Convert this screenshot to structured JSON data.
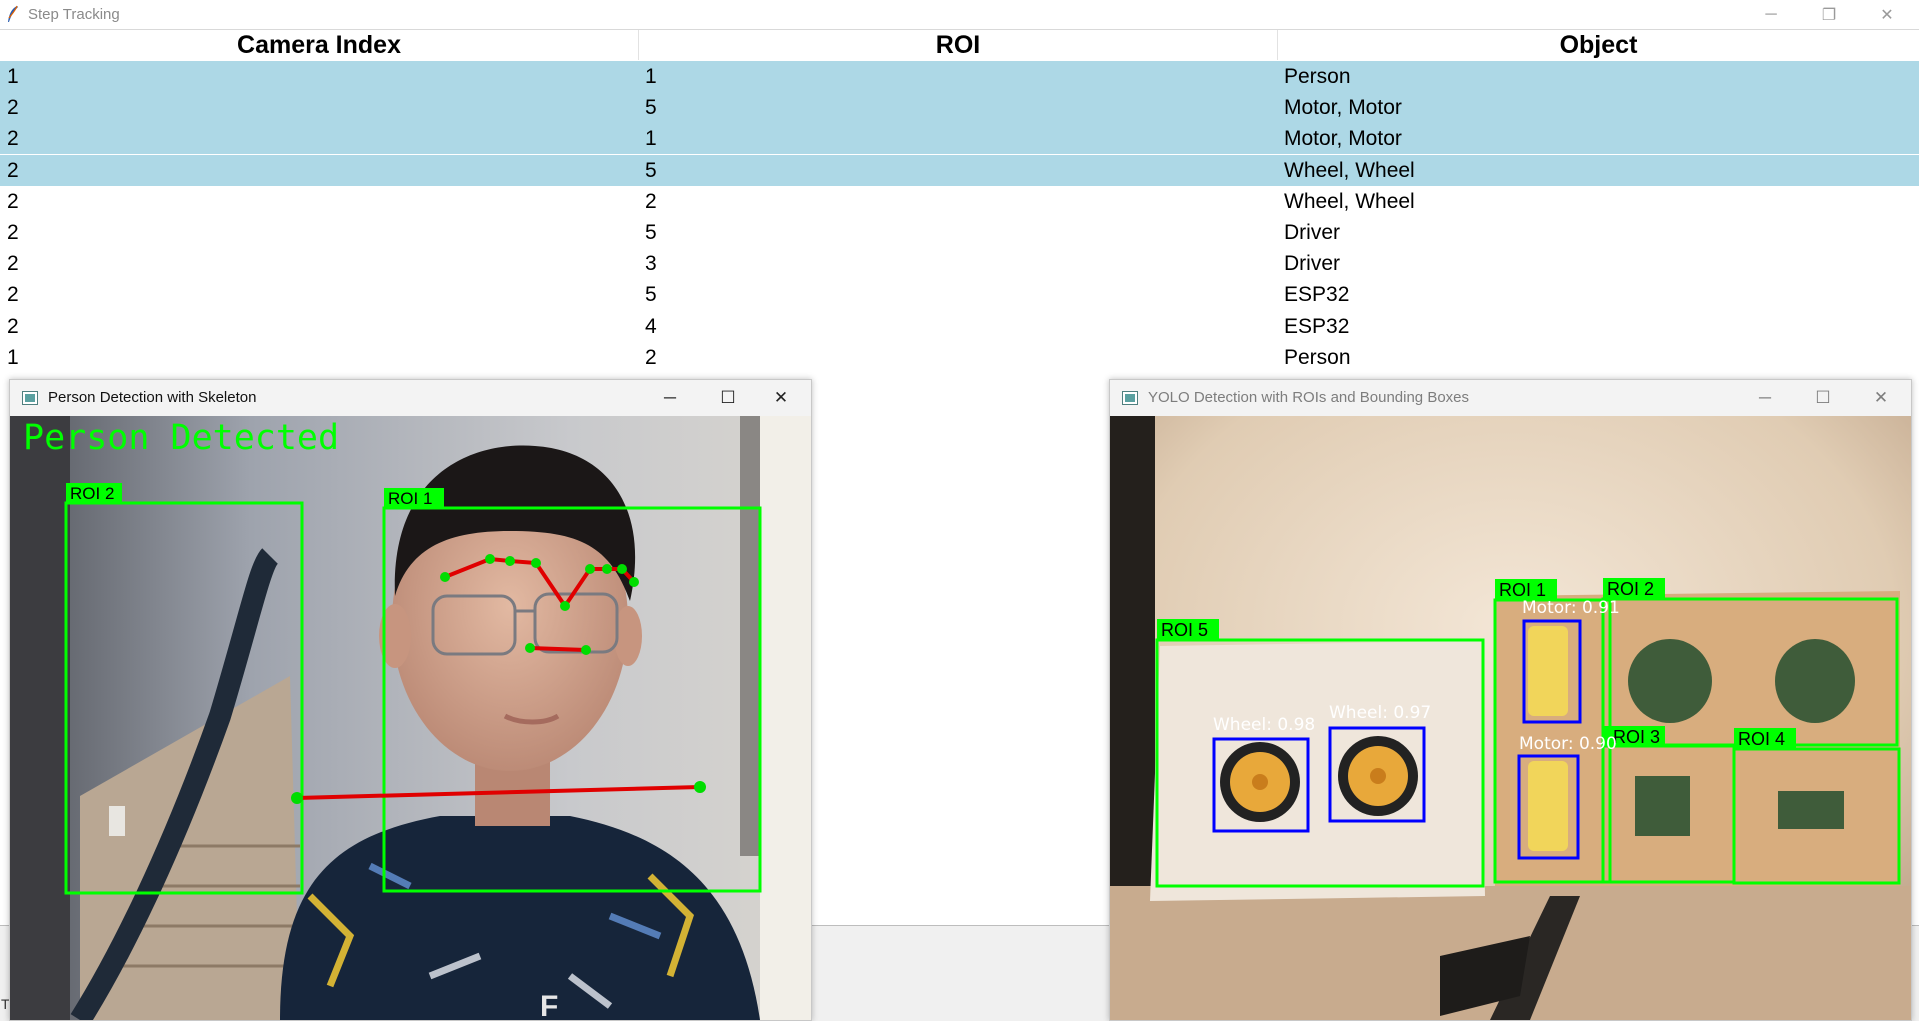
{
  "main_window": {
    "title": "Step Tracking",
    "bottom_text": "T"
  },
  "table": {
    "columns": [
      "Camera Index",
      "ROI",
      "Object"
    ],
    "rows": [
      {
        "camera": "1",
        "roi": "1",
        "object": "Person",
        "selected": true
      },
      {
        "camera": "2",
        "roi": "5",
        "object": "Motor, Motor",
        "selected": true
      },
      {
        "camera": "2",
        "roi": "1",
        "object": "Motor, Motor",
        "selected": true
      },
      {
        "camera": "2",
        "roi": "5",
        "object": "Wheel, Wheel",
        "selected": true
      },
      {
        "camera": "2",
        "roi": "2",
        "object": "Wheel, Wheel",
        "selected": false
      },
      {
        "camera": "2",
        "roi": "5",
        "object": "Driver",
        "selected": false
      },
      {
        "camera": "2",
        "roi": "3",
        "object": "Driver",
        "selected": false
      },
      {
        "camera": "2",
        "roi": "5",
        "object": "ESP32",
        "selected": false
      },
      {
        "camera": "2",
        "roi": "4",
        "object": "ESP32",
        "selected": false
      },
      {
        "camera": "1",
        "roi": "2",
        "object": "Person",
        "selected": false
      }
    ]
  },
  "person_window": {
    "title": "Person Detection with Skeleton",
    "status": "Person Detected",
    "roi_labels": [
      "ROI 2",
      "ROI 1"
    ]
  },
  "yolo_window": {
    "title": "YOLO Detection with ROIs and Bounding Boxes",
    "roi_labels": [
      "ROI 1",
      "ROI 2",
      "ROI 3",
      "ROI 4",
      "ROI 5"
    ],
    "detections": [
      "Motor: 0.91",
      "Motor: 0.90",
      "Wheel: 0.98",
      "Wheel: 0.97"
    ]
  },
  "colors": {
    "selection": "#add8e6",
    "roi_green": "#00ff00",
    "skeleton_red": "#e00000",
    "bbox_blue": "#0000ff"
  },
  "icons": [
    "feather-icon",
    "minimize-icon",
    "maximize-icon",
    "close-icon",
    "restore-icon"
  ]
}
